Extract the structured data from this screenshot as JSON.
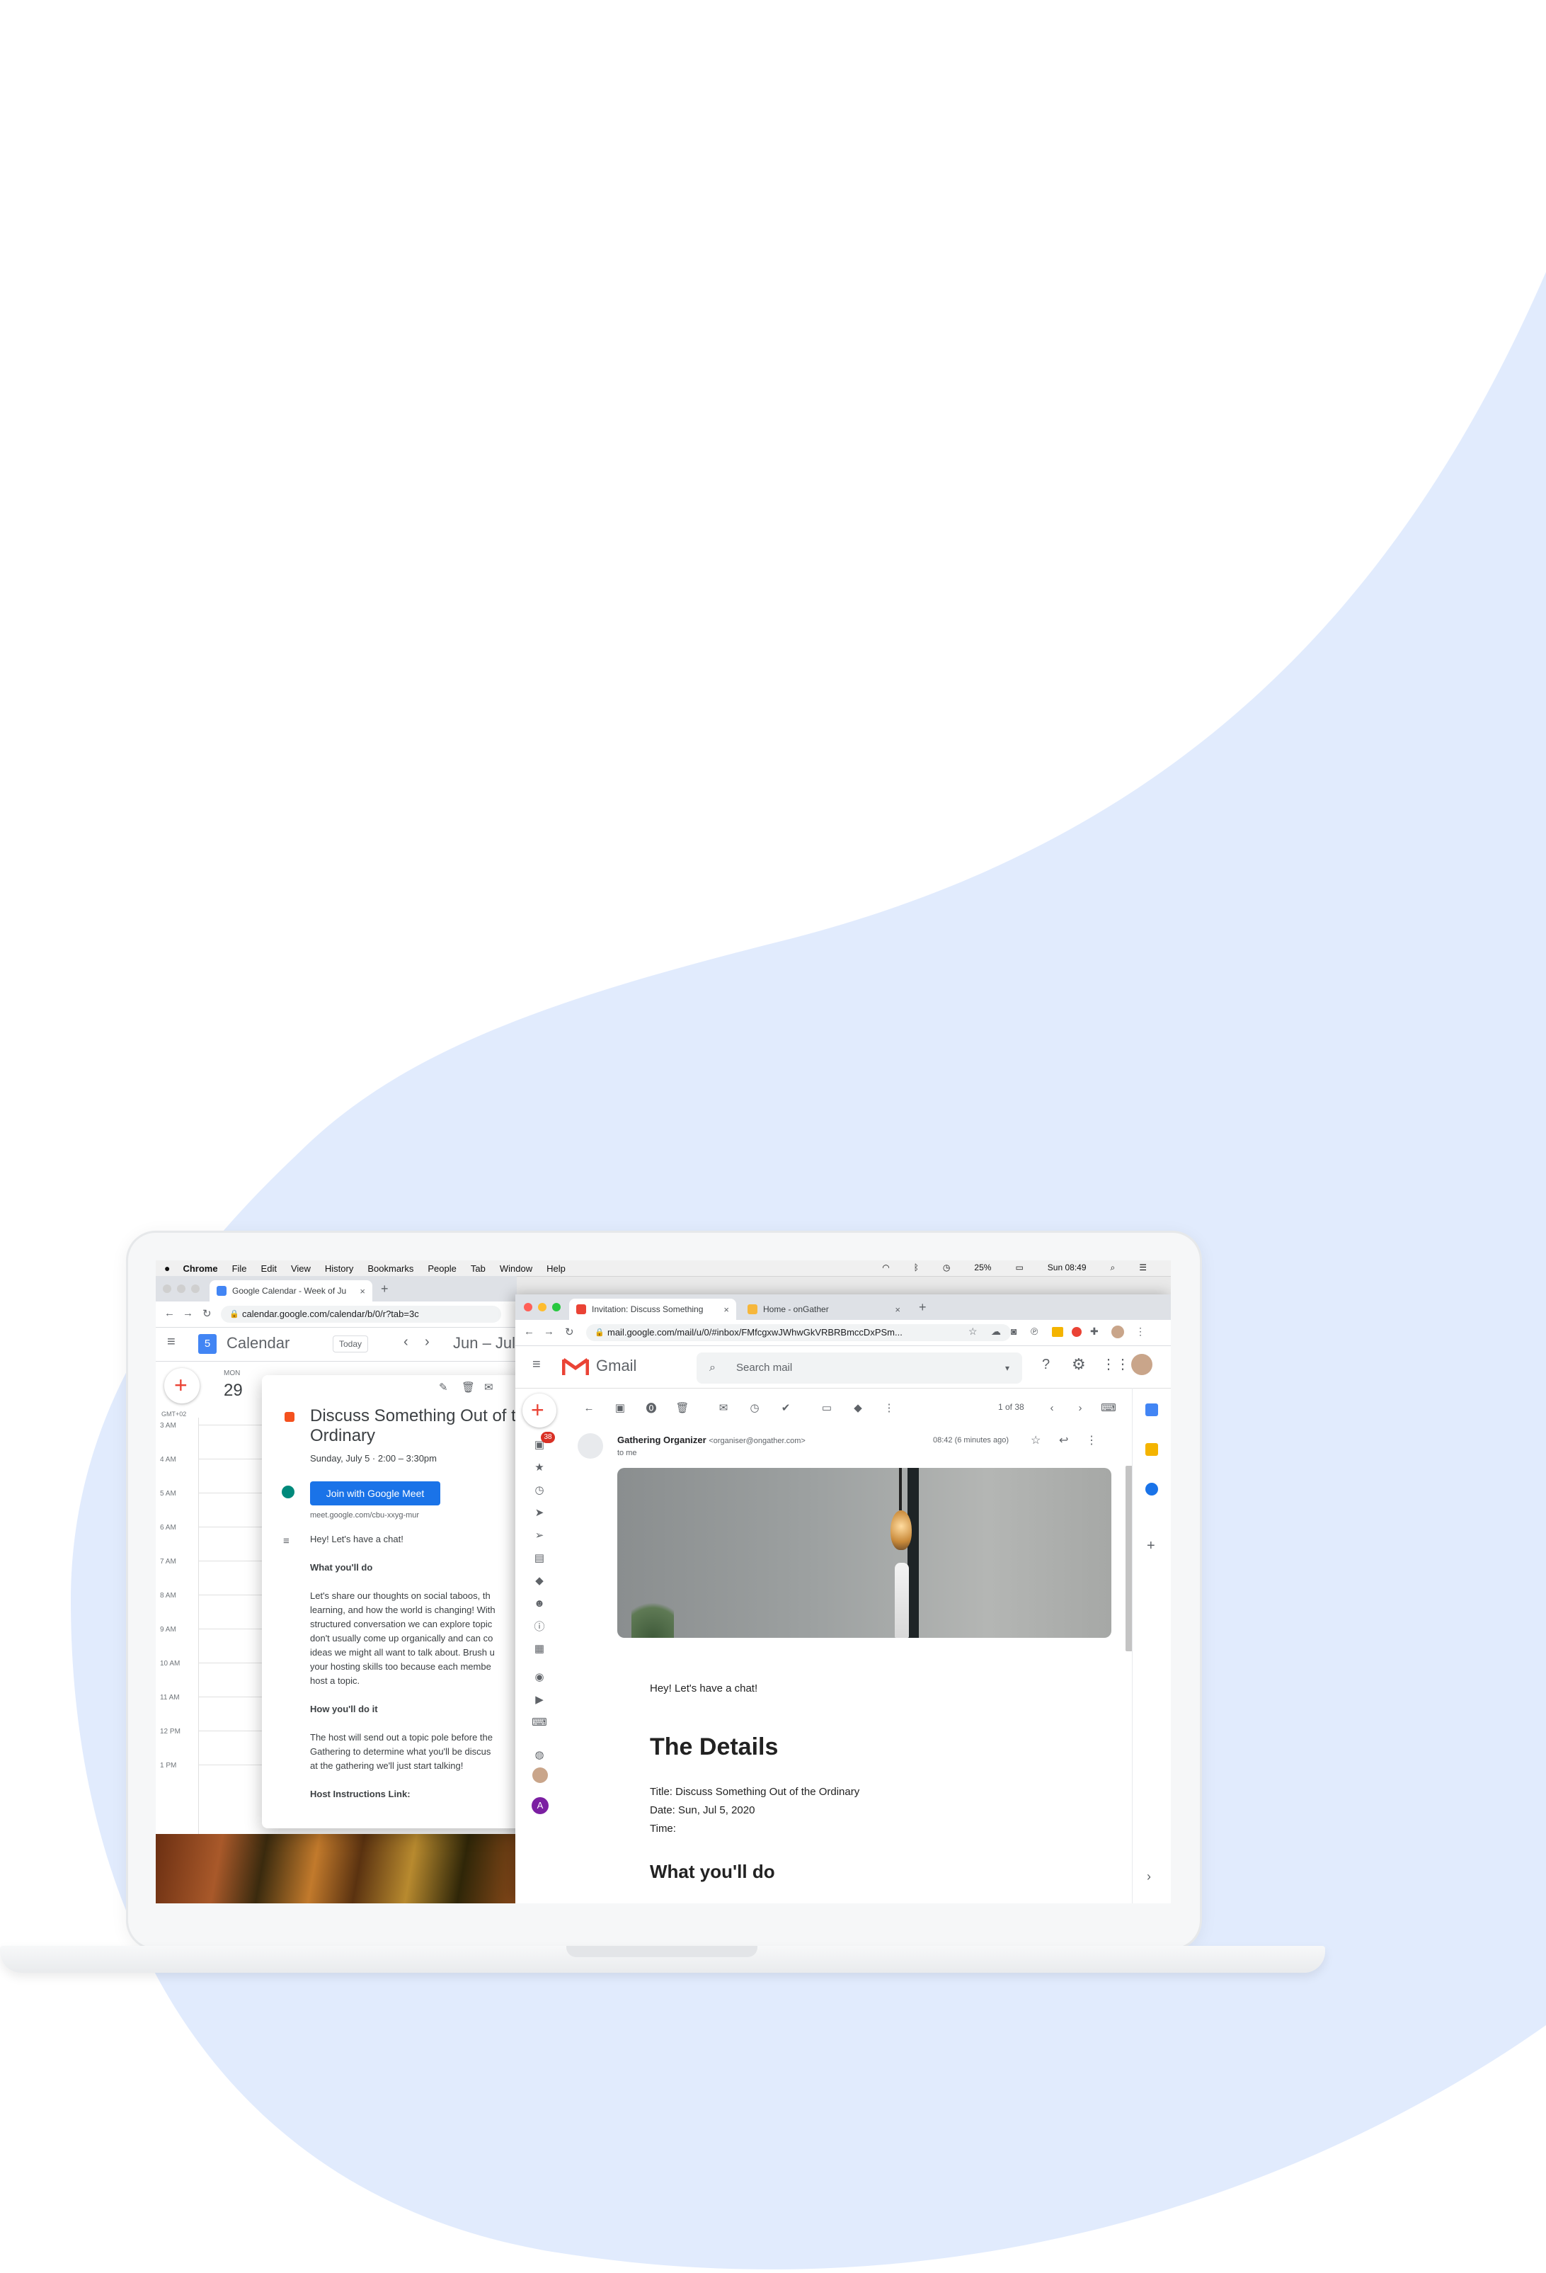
{
  "colors": {
    "background_shape": "#e1ebfd",
    "accent_blue": "#1a73e8",
    "gmail_red": "#ea4335"
  },
  "menubar": {
    "apple": "",
    "app": "Chrome",
    "items": [
      "File",
      "Edit",
      "View",
      "History",
      "Bookmarks",
      "People",
      "Tab",
      "Window",
      "Help"
    ],
    "battery": "25%",
    "clock": "Sun 08:49"
  },
  "calendar_browser": {
    "tab_title": "Google Calendar - Week of Ju",
    "url": "calendar.google.com/calendar/b/0/r?tab=3c",
    "app_name": "Calendar",
    "today_button": "Today",
    "date_range": "Jun – Jul",
    "day_name": "MON",
    "day_number": "29",
    "timezone": "GMT+02",
    "hours": [
      "3 AM",
      "4 AM",
      "5 AM",
      "6 AM",
      "7 AM",
      "8 AM",
      "9 AM",
      "10 AM",
      "11 AM",
      "12 PM",
      "1 PM"
    ]
  },
  "event_popup": {
    "title_line1": "Discuss Something Out of th",
    "title_line2": "Ordinary",
    "datetime": "Sunday, July 5  ·  2:00 – 3:30pm",
    "meet_button": "Join with Google Meet",
    "meet_link": "meet.google.com/cbu-xxyg-mur",
    "greeting": "Hey! Let's have a chat!",
    "what_heading": "What you'll do",
    "what_lines": [
      "Let's share our thoughts on social taboos, th",
      "learning, and how the world is changing! With",
      "structured conversation we can explore topic",
      "don't usually come up organically and can co",
      "ideas we might all want to talk about. Brush u",
      "your hosting skills too because each membe",
      "host a topic."
    ],
    "how_heading": "How you'll do it",
    "how_lines": [
      "The host will send out a topic pole before the",
      "Gathering to determine what you'll be discus",
      "at the gathering we'll just start talking!"
    ],
    "host_heading": "Host Instructions Link:"
  },
  "gmail_browser": {
    "tabs": [
      {
        "title": "Invitation: Discuss Something",
        "active": true
      },
      {
        "title": "Home - onGather",
        "active": false
      }
    ],
    "url": "mail.google.com/mail/u/0/#inbox/FMfcgxwJWhwGkVRBRBmccDxPSm...",
    "logo_text": "Gmail",
    "search_placeholder": "Search mail",
    "unread_badge": "38",
    "pagination": "1 of 38",
    "sender_name": "Gathering Organizer",
    "sender_email": "<organiser@ongather.com>",
    "recipient": "to me",
    "time": "08:42 (6 minutes ago)",
    "avatar_letter": "A",
    "body": {
      "greeting": "Hey! Let's have a chat!",
      "details_heading": "The Details",
      "title_line": "Title: Discuss Something Out of the Ordinary",
      "date_line": "Date: Sun, Jul 5, 2020",
      "time_line": "Time:",
      "what_heading": "What you'll do"
    }
  }
}
